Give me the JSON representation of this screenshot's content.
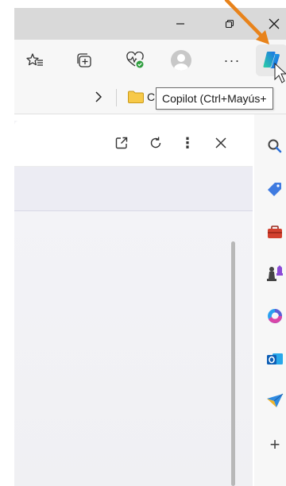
{
  "window": {
    "minimize_glyph": "—",
    "close_glyph": "✕"
  },
  "toolbar": {
    "icons": [
      "favorites-icon",
      "collections-icon",
      "browser-essentials-icon",
      "profile-avatar-icon",
      "more-icon",
      "copilot-icon"
    ],
    "more_label": "···"
  },
  "favorites_bar": {
    "chevron": "›",
    "folder_label": "C"
  },
  "tooltip": {
    "text": "Copilot (Ctrl+Mayús+"
  },
  "pane": {
    "more_label": "⋮",
    "icons": [
      "popout-icon",
      "refresh-icon",
      "more-options-icon",
      "close-icon"
    ]
  },
  "sidebar": {
    "items": [
      {
        "icon": "search-icon"
      },
      {
        "icon": "shopping-tag-icon"
      },
      {
        "icon": "tools-icon"
      },
      {
        "icon": "games-icon"
      },
      {
        "icon": "microsoft-365-icon"
      },
      {
        "icon": "outlook-icon"
      },
      {
        "icon": "drop-send-icon"
      },
      {
        "icon": "add-icon"
      }
    ],
    "add_label": "+"
  },
  "colors": {
    "titlebar": "#d9d9d9",
    "toolbar": "#f7f7f7",
    "arrow": "#e8831b",
    "copilot_blue": "#1b73e8"
  }
}
